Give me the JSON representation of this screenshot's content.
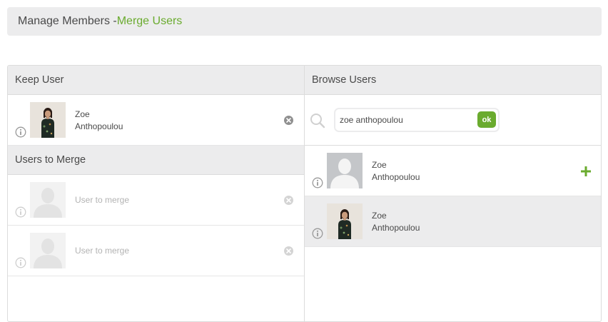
{
  "header": {
    "title_prefix": "Manage Members - ",
    "title_accent": "Merge Users"
  },
  "keep_user": {
    "heading": "Keep User",
    "user": {
      "first_name": "Zoe",
      "last_name": "Anthopoulou",
      "has_photo": true
    }
  },
  "users_to_merge": {
    "heading": "Users to Merge",
    "slots": [
      {
        "placeholder": "User to merge"
      },
      {
        "placeholder": "User to merge"
      }
    ]
  },
  "browse_users": {
    "heading": "Browse Users",
    "search": {
      "value": "zoe anthopoulou",
      "button_label": "ok"
    },
    "results": [
      {
        "first_name": "Zoe",
        "last_name": "Anthopoulou",
        "has_photo": false,
        "selected": false
      },
      {
        "first_name": "Zoe",
        "last_name": "Anthopoulou",
        "has_photo": true,
        "selected": true
      }
    ]
  },
  "colors": {
    "accent": "#6aab2e",
    "header_bg": "#ececed",
    "border": "#dcdcdc"
  }
}
